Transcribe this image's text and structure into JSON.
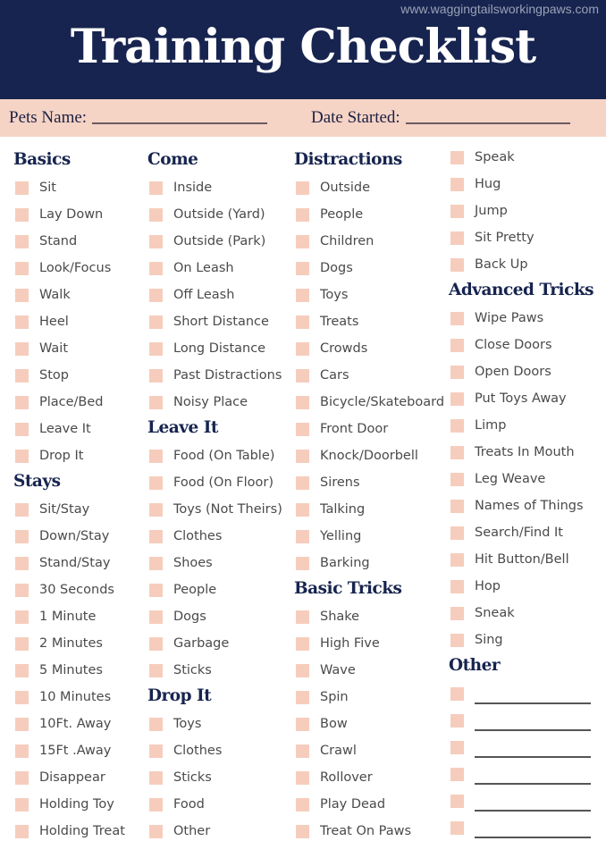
{
  "website": "www.waggingtailsworkingpaws.com",
  "title": "Training Checklist",
  "fields": {
    "pets_name_label": "Pets Name:",
    "pets_name_value": "",
    "date_started_label": "Date Started:",
    "date_started_value": ""
  },
  "colors": {
    "navy": "#17244f",
    "peach": "#f5d3c5",
    "checkbox": "#f6cdbd"
  },
  "columns": [
    {
      "sections": [
        {
          "title": "Basics",
          "items": [
            "Sit",
            "Lay Down",
            "Stand",
            "Look/Focus",
            "Walk",
            "Heel",
            "Wait",
            "Stop",
            "Place/Bed",
            "Leave It",
            "Drop It"
          ]
        },
        {
          "title": "Stays",
          "items": [
            "Sit/Stay",
            "Down/Stay",
            "Stand/Stay",
            "30 Seconds",
            "1 Minute",
            "2 Minutes",
            "5 Minutes",
            "10 Minutes",
            "10Ft. Away",
            "15Ft .Away",
            "Disappear",
            "Holding Toy",
            "Holding Treat"
          ]
        }
      ]
    },
    {
      "sections": [
        {
          "title": "Come",
          "items": [
            "Inside",
            "Outside (Yard)",
            "Outside (Park)",
            "On Leash",
            "Off Leash",
            "Short Distance",
            "Long Distance",
            "Past Distractions",
            "Noisy Place"
          ]
        },
        {
          "title": "Leave It",
          "items": [
            "Food (On Table)",
            "Food (On Floor)",
            "Toys (Not Theirs)",
            "Clothes",
            "Shoes",
            "People",
            "Dogs",
            "Garbage",
            "Sticks"
          ]
        },
        {
          "title": "Drop It",
          "items": [
            "Toys",
            "Clothes",
            "Sticks",
            "Food",
            "Other"
          ]
        }
      ]
    },
    {
      "sections": [
        {
          "title": "Distractions",
          "items": [
            "Outside",
            "People",
            "Children",
            "Dogs",
            "Toys",
            "Treats",
            "Crowds",
            "Cars",
            "Bicycle/Skateboard",
            "Front Door",
            "Knock/Doorbell",
            "Sirens",
            "Talking",
            "Yelling",
            "Barking"
          ]
        },
        {
          "title": "Basic Tricks",
          "items": [
            "Shake",
            "High Five",
            "Wave",
            "Spin",
            "Bow",
            "Crawl",
            "Rollover",
            "Play Dead",
            "Treat On Paws"
          ]
        }
      ]
    },
    {
      "sections": [
        {
          "title": "",
          "items": [
            "Speak",
            "Hug",
            "Jump",
            "Sit Pretty",
            "Back Up"
          ]
        },
        {
          "title": "Advanced Tricks",
          "items": [
            "Wipe Paws",
            "Close Doors",
            "Open Doors",
            "Put Toys Away",
            "Limp",
            "Treats In Mouth",
            "Leg Weave",
            "Names of Things",
            "Search/Find It",
            "Hit Button/Bell",
            "Hop",
            "Sneak",
            "Sing"
          ]
        },
        {
          "title": "Other",
          "items": [],
          "blank_lines": 6
        }
      ]
    }
  ]
}
